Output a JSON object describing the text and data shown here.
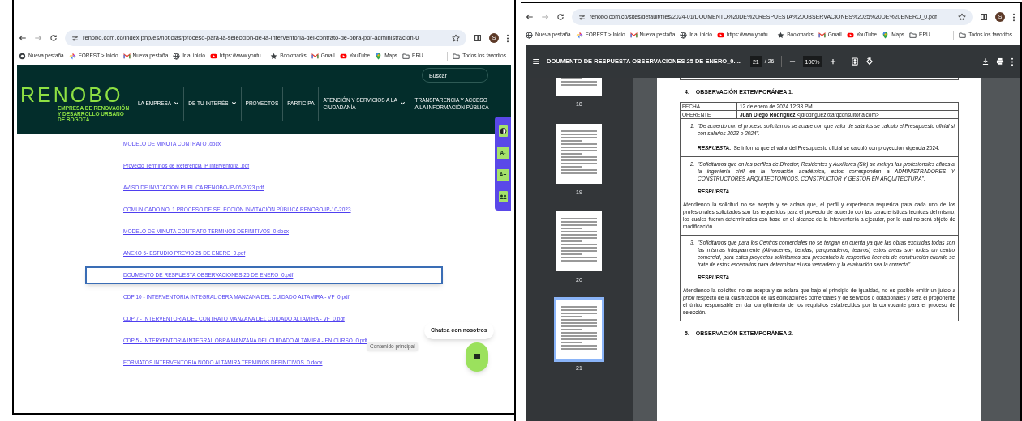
{
  "left_window": {
    "url": "renobo.com.co/index.php/es/noticias/proceso-para-la-seleccion-de-la-interventoria-del-contrato-de-obra-por-administracion-0",
    "avatar_initial": "S",
    "bookmarks": [
      {
        "kind": "page",
        "label": "Nueva pestaña"
      },
      {
        "kind": "diamond",
        "label": "FOREST > Inicio"
      },
      {
        "kind": "mail",
        "label": "Nueva pestaña"
      },
      {
        "kind": "globe",
        "label": "Ir al inicio"
      },
      {
        "kind": "video",
        "label": "https://www.youtu..."
      },
      {
        "kind": "star",
        "label": "Bookmarks"
      },
      {
        "kind": "mail",
        "label": "Gmail"
      },
      {
        "kind": "video",
        "label": "YouTube"
      },
      {
        "kind": "pin",
        "label": "Maps"
      },
      {
        "kind": "folder",
        "label": "ERU"
      }
    ],
    "all_bookmarks": "Todos los favoritos",
    "site": {
      "logo": "RENOBO",
      "logo_subtitle": "EMPRESA DE RENOVACIÓN Y DESARROLLO URBANO DE BOGOTÁ",
      "search": {
        "placeholder": "Buscar"
      },
      "nav": [
        {
          "label": "LA EMPRESA",
          "dropdown": true
        },
        {
          "label": "DE TU INTERÉS",
          "dropdown": true
        },
        {
          "label": "PROYECTOS",
          "dropdown": false
        },
        {
          "label": "PARTICIPA",
          "dropdown": false
        },
        {
          "label": "ATENCIÓN Y SERVICIOS A LA CIUDADANÍA",
          "dropdown": true
        },
        {
          "label": "TRANSPARENCIA Y ACCESO A LA INFORMACIÓN PÚBLICA",
          "dropdown": false
        }
      ],
      "accessibility": [
        "A-",
        "A+"
      ],
      "links": [
        {
          "label": "MODELO DE MINUTA CONTRATO .docx",
          "selected": false
        },
        {
          "label": "Proyecto Términos de Referencia IP Interventoria .pdf",
          "selected": false
        },
        {
          "label": "AVISO DE INVITACION PUBLICA RENOBO-IP-06-2023.pdf",
          "selected": false
        },
        {
          "label": "COMUNICADO NO. 1 PROCESO DE SELECCIÓN INVITACIÓN PÚBLICA RENOBO-IP-10-2023",
          "selected": false
        },
        {
          "label": "MODELO DE MINUTA CONTRATO TERMINOS DEFINITIVOS_0.docx",
          "selected": false
        },
        {
          "label": "ANEXO 5- ESTUDIO PREVIO 25 DE ENERO_0.pdf",
          "selected": false
        },
        {
          "label": "DOUMENTO DE RESPUESTA OBSERVACIONES 25 DE ENERO_0.pdf",
          "selected": true
        },
        {
          "label": "CDP 10 - INTERVENTORIA INTEGRAL OBRA MANZANA DEL CUIDADO ALTAMIRA - VF_0.pdf",
          "selected": false
        },
        {
          "label": "CDP 7 - INTERVENTORIA DEL CONTRATO MANZANA DEL CUIDADO ALTAMIRA - VF_0.pdf",
          "selected": false
        },
        {
          "label": "CDP 5 - INTERVENTORIA INTEGRAL OBRA MANZANA DEL CUIDADO ALTAMIRA - EN CURSO_0.pdf",
          "selected": false
        },
        {
          "label": "FORMATOS INTERVENTORIA NODO ALTAMIRA TERMINOS DEFINITIVOS_0.docx",
          "selected": false
        }
      ],
      "tooltip": "Contenido principal",
      "chat": "Chatea con nosotros"
    }
  },
  "right_window": {
    "url": "renobo.com.co/sites/default/files/2024-01/DOUMENTO%20DE%20RESPUESTA%20OBSERVACIONES%2025%20DE%20ENERO_0.pdf",
    "avatar_initial": "S",
    "bookmarks": [
      {
        "kind": "globe",
        "label": "Nueva pestaña"
      },
      {
        "kind": "diamond",
        "label": "FOREST > Inicio"
      },
      {
        "kind": "mail",
        "label": "Nueva pestaña"
      },
      {
        "kind": "globe",
        "label": "Ir al inicio"
      },
      {
        "kind": "video",
        "label": "https://www.youtu..."
      },
      {
        "kind": "star",
        "label": "Bookmarks"
      },
      {
        "kind": "mail",
        "label": "Gmail"
      },
      {
        "kind": "video",
        "label": "YouTube"
      },
      {
        "kind": "pin",
        "label": "Maps"
      },
      {
        "kind": "folder",
        "label": "ERU"
      }
    ],
    "all_bookmarks": "Todos los favoritos",
    "pdf": {
      "title": "DOUMENTO DE RESPUESTA OBSERVACIONES 25 DE ENERO_0....",
      "page": "21",
      "page_total": "/ 26",
      "zoom": "100%",
      "thumbnails": [
        {
          "label": "18",
          "selected": false
        },
        {
          "label": "19",
          "selected": false
        },
        {
          "label": "20",
          "selected": false
        },
        {
          "label": "21",
          "selected": true
        }
      ],
      "document": {
        "section": {
          "number": "4.",
          "title": "OBSERVACIÓN EXTEMPORÁNEA 1."
        },
        "table": [
          {
            "field": "FECHA",
            "value": "12 de enero de 2024 12:33 PM"
          },
          {
            "field": "OFERENTE",
            "value": "**Juan Diego Rodriguez** <jdrodriguez@arqconsultoria.com>"
          }
        ],
        "items": [
          {
            "kind": "inline",
            "number": "1.",
            "question": "\"De acuerdo con el proceso solicitamos se aclare con que valor de salarios se calculo el Presupuesto oficial si con salarios 2023 o 2024\".",
            "answer_label": "RESPUESTA:",
            "answer": "Se informa que el valor del Presupuesto oficial se calculó con proyección vigencia 2024."
          },
          {
            "kind": "block",
            "number": "2.",
            "question": "\"Solicitamos que en los perfiles de Director, Residentes y Auxiliares (Sic) se incluya las profesionales afines a la ingeniería civil en la formación académica, estos corresponden a ADMINISTRADORES Y CONSTRUCTORES ARQUITECTONICOS, CONSTRUCTOR Y GESTOR EN ARQUITECTURA\".",
            "answer_label": "RESPUESTA",
            "answer": "Atendiendo la solicitud no se acepta y se aclara que, el perfil y experiencia requerida para cada uno de los profesionales solicitados son los requeridos para el proyecto de acuerdo con las características técnicas del mismo, los cuales fueron determinados con base en el alcance de la interventoría a ejecutar, por lo cual no será objeto de modificación."
          },
          {
            "kind": "block",
            "number": "3.",
            "question": "\"Solicitamos que para los Centros comerciales no se tengan en cuenta ya que las obras excluidas todas son las mismas integralmente (Almacenes, tiendas, parqueaderos, teatros) estos aréas son todas un centro comercial, para estos proyectos solicitamos sea presentado la respectiva licencia de construcción cuando se trate de estos escenarios para determinar el uso verdadero y la evaluación sea la correcta\".",
            "answer_label": "RESPUESTA",
            "answer": "Atendiendo la solicitud no se acepta y se aclara que bajo el principio de igualdad, no es posible emitir un juicio *a priori* respecto de la clasificación de las edificaciones comerciales y de servicios o dotacionales y será el proponente el único responsable en dar cumplimiento de los requisitos establecidos por la convocante para el proceso de selección."
          }
        ],
        "next_section": {
          "number": "5.",
          "title": "OBSERVACIÓN EXTEMPORÁNEA 2."
        }
      }
    }
  }
}
